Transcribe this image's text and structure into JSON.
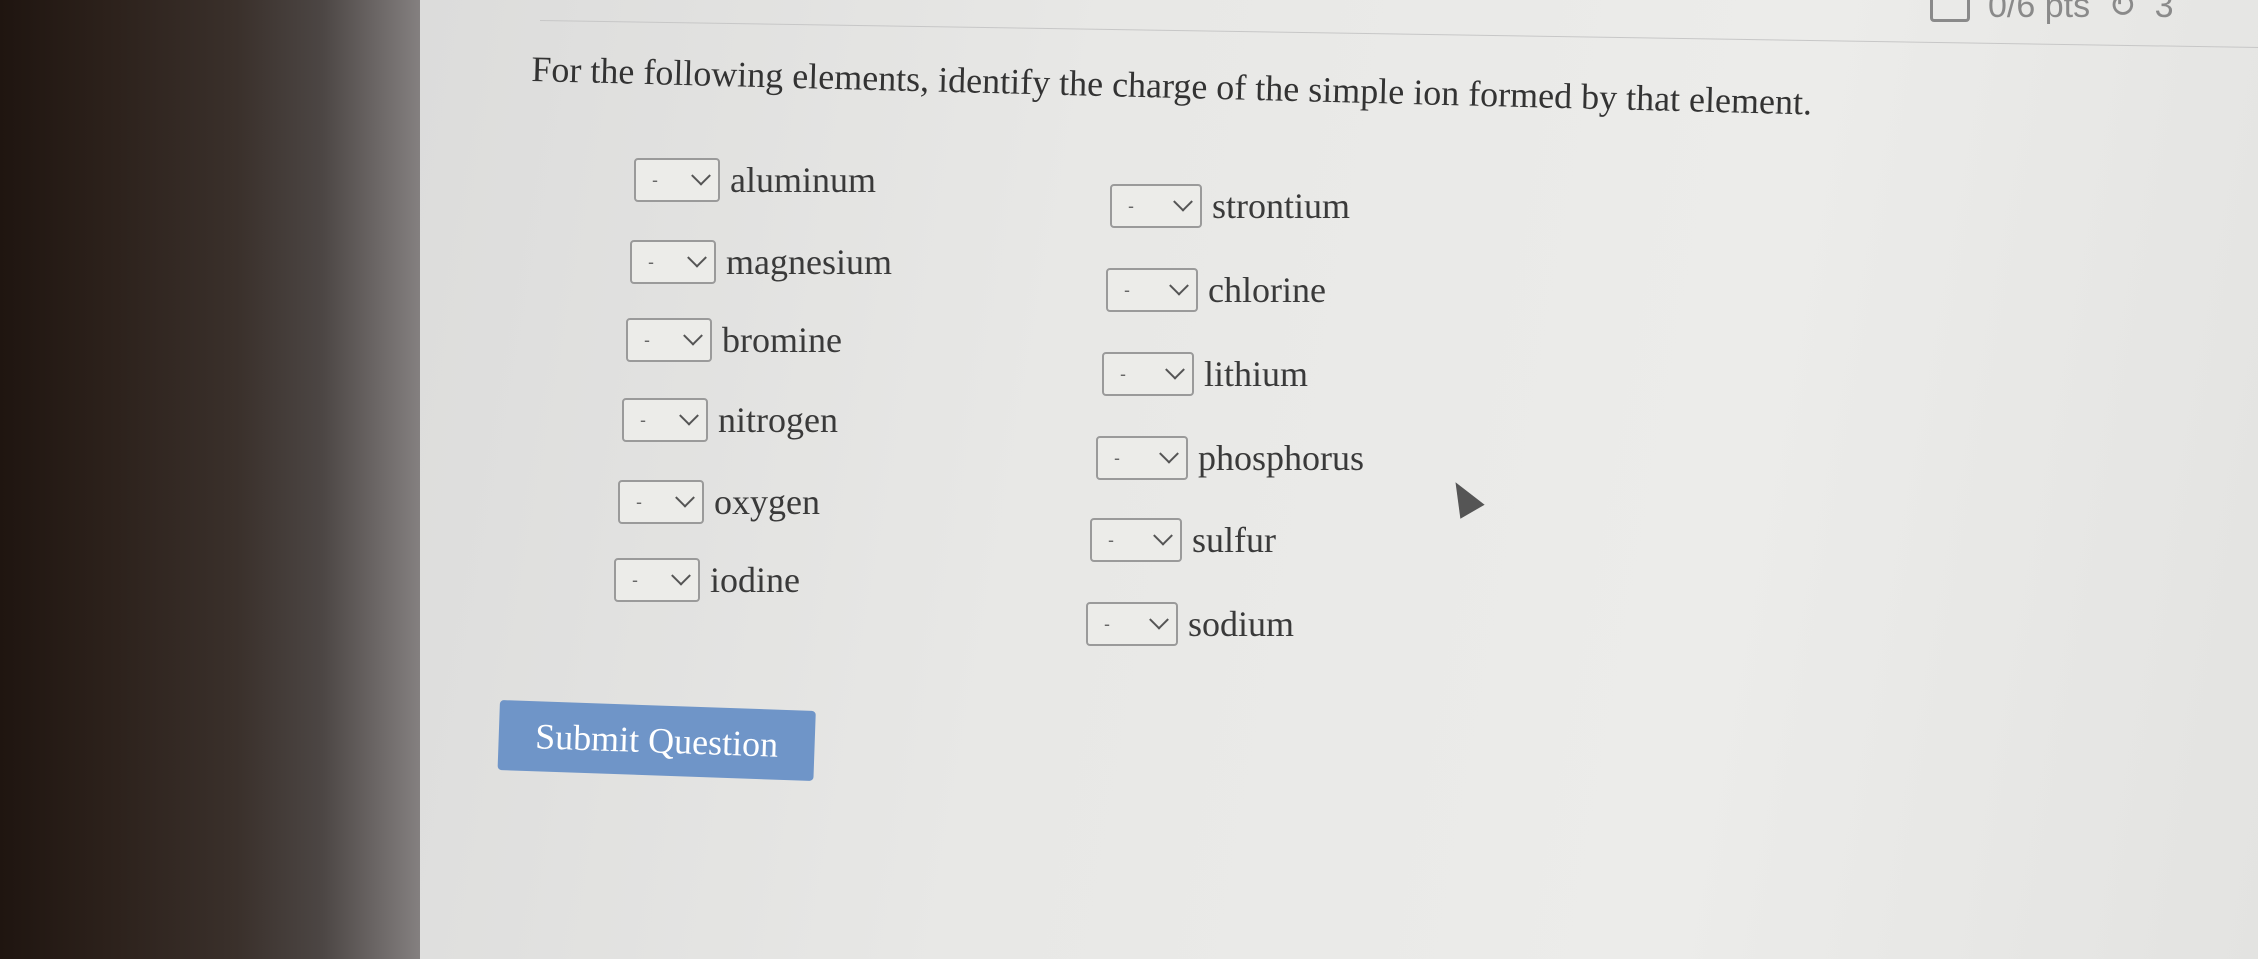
{
  "header": {
    "points": "0/6 pts",
    "retries": "3"
  },
  "question": "For the following elements, identify the charge of the simple ion formed by that element.",
  "left_items": [
    {
      "label": "aluminum",
      "value": "-"
    },
    {
      "label": "magnesium",
      "value": "-"
    },
    {
      "label": "bromine",
      "value": "-"
    },
    {
      "label": "nitrogen",
      "value": "-"
    },
    {
      "label": "oxygen",
      "value": "-"
    },
    {
      "label": "iodine",
      "value": "-"
    }
  ],
  "right_items": [
    {
      "label": "strontium",
      "value": "-"
    },
    {
      "label": "chlorine",
      "value": "-"
    },
    {
      "label": "lithium",
      "value": "-"
    },
    {
      "label": "phosphorus",
      "value": "-"
    },
    {
      "label": "sulfur",
      "value": "-"
    },
    {
      "label": "sodium",
      "value": "-"
    }
  ],
  "submit_label": "Submit Question"
}
